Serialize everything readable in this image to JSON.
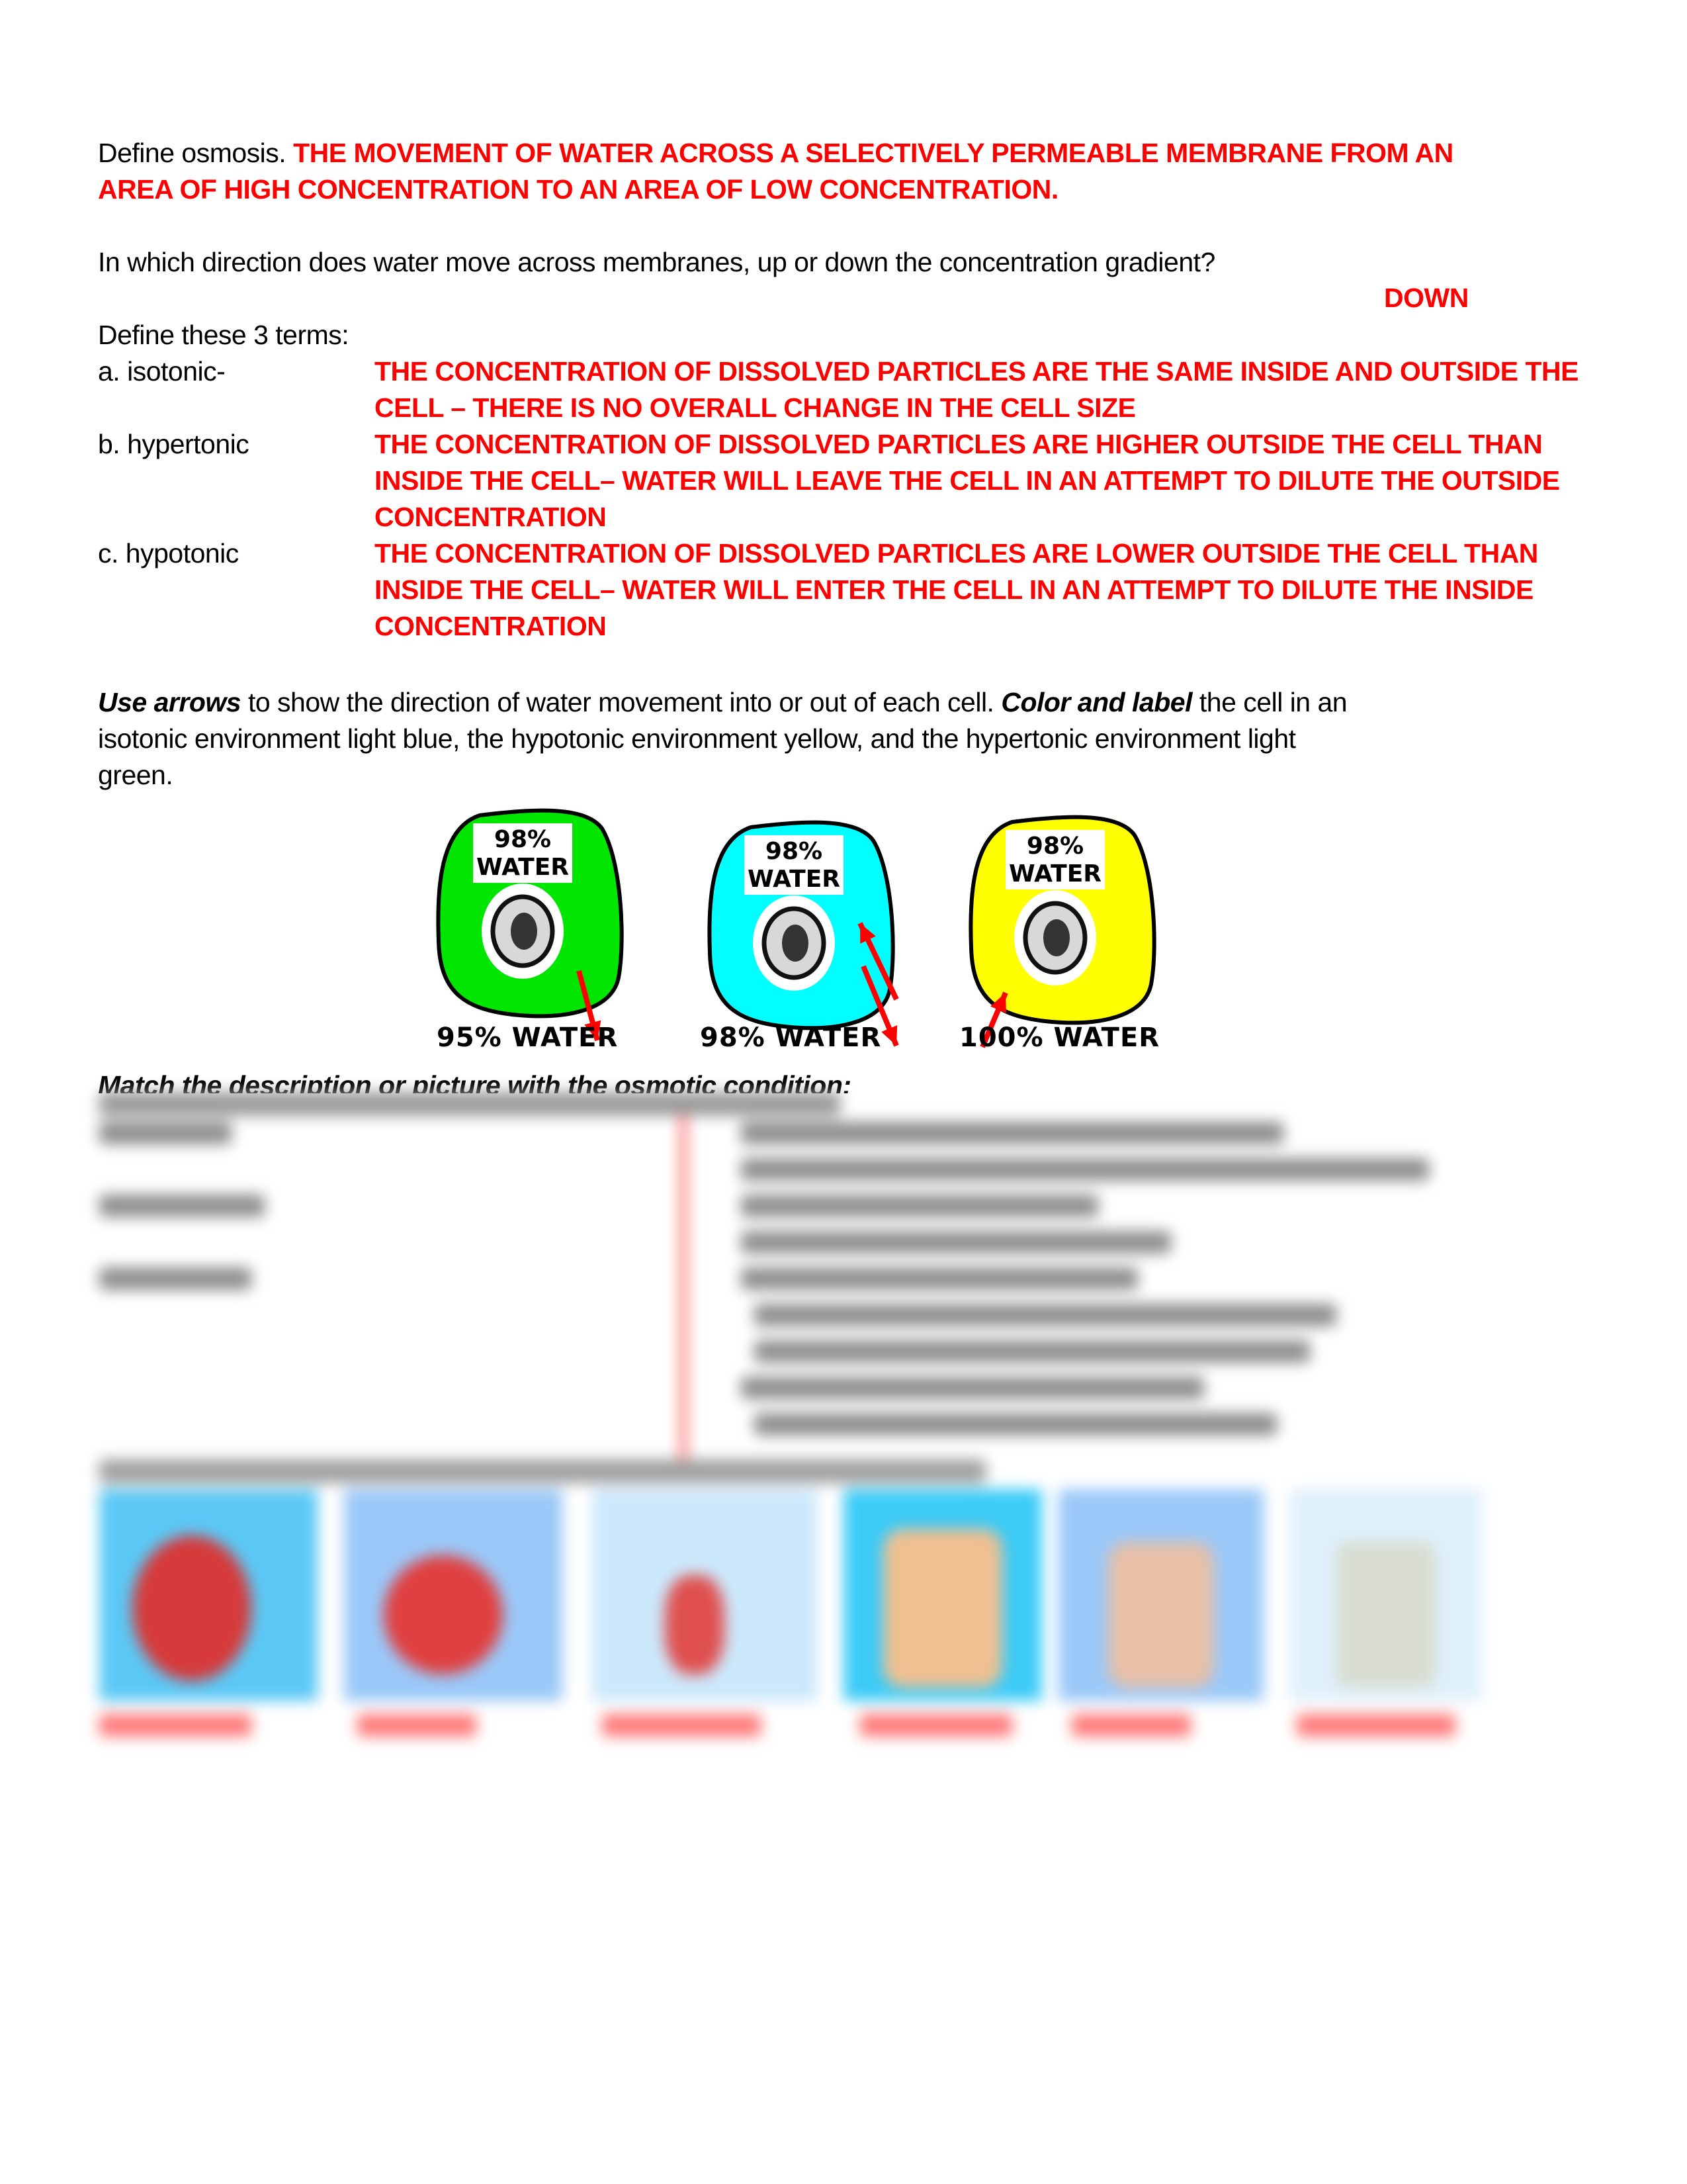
{
  "q1": {
    "prompt": "Define osmosis.",
    "answer_line1": "THE MOVEMENT OF WATER ACROSS A SELECTIVELY PERMEABLE MEMBRANE FROM AN",
    "answer_line2": "AREA OF HIGH CONCENTRATION TO AN AREA OF LOW CONCENTRATION."
  },
  "q2": {
    "prompt": "In which direction does water move across membranes, up or down the concentration gradient?",
    "answer": "DOWN"
  },
  "q3": {
    "prompt": "Define these 3 terms:",
    "terms": [
      {
        "label": "a. isotonic-",
        "lines": [
          "THE CONCENTRATION OF DISSOLVED PARTICLES ARE THE SAME INSIDE AND OUTSIDE THE",
          "CELL – THERE IS NO OVERALL CHANGE IN THE CELL SIZE"
        ]
      },
      {
        "label": "b. hypertonic",
        "lines": [
          "THE CONCENTRATION OF DISSOLVED PARTICLES ARE HIGHER OUTSIDE THE CELL THAN",
          "INSIDE THE CELL– WATER WILL LEAVE THE CELL IN AN ATTEMPT TO DILUTE THE OUTSIDE",
          "CONCENTRATION"
        ]
      },
      {
        "label": "c. hypotonic",
        "lines": [
          "THE CONCENTRATION OF DISSOLVED PARTICLES ARE LOWER OUTSIDE THE CELL THAN",
          "INSIDE THE CELL– WATER WILL ENTER THE CELL IN AN ATTEMPT TO DILUTE THE INSIDE",
          "CONCENTRATION"
        ]
      }
    ]
  },
  "q4": {
    "instr_bold1": "Use arrows",
    "instr_text1": " to show the direction of water movement into or out of each cell.  ",
    "instr_bold2": "Color and label",
    "instr_text2": " the cell in an",
    "instr_line2": "isotonic environment light blue, the hypotonic environment yellow, and the hypertonic environment light",
    "instr_line3": "green.",
    "cells": [
      {
        "inside_pct": "98%",
        "inside_word": "WATER",
        "outside_label": "95% WATER",
        "fill": "#00e600",
        "arrows": "out"
      },
      {
        "inside_pct": "98%",
        "inside_word": "WATER",
        "outside_label": "98% WATER",
        "fill": "#00ffff",
        "arrows": "both"
      },
      {
        "inside_pct": "98%",
        "inside_word": "WATER",
        "outside_label": "100% WATER",
        "fill": "#ffff00",
        "arrows": "in"
      }
    ],
    "arrow_color": "#ff0000"
  },
  "q5": {
    "heading": "Match the description or picture with the osmotic condition:"
  },
  "colors": {
    "answer_red": "#ff0000",
    "text": "#000000"
  }
}
